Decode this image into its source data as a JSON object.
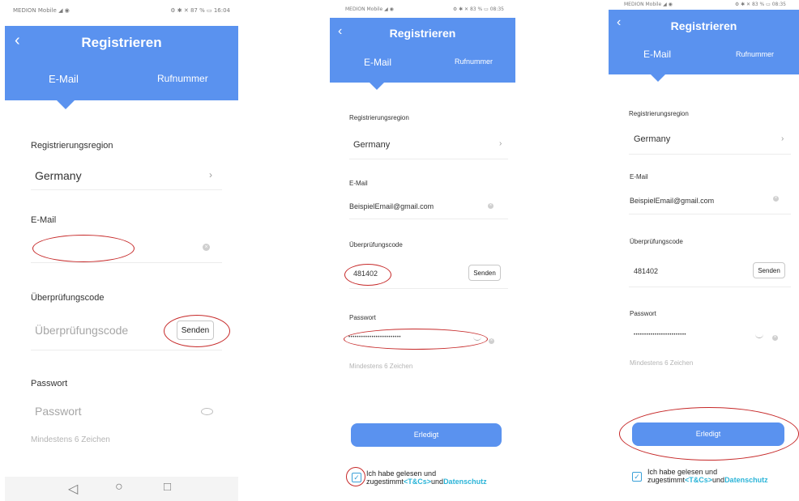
{
  "screens": [
    {
      "status_left": "MEDION Mobile ◢ ◉",
      "status_right": "⚙ ✱ ✕ 87 % ▭ 16:04",
      "title": "Registrieren",
      "tab_email": "E-Mail",
      "tab_phone": "Rufnummer",
      "region_label": "Registrierungsregion",
      "region_value": "Germany",
      "email_label": "E-Mail",
      "email_value": "",
      "code_label": "Überprüfungscode",
      "code_placeholder": "Überprüfungscode",
      "send_label": "Senden",
      "password_label": "Passwort",
      "password_placeholder": "Passwort",
      "password_hint": "Mindestens 6 Zeichen"
    },
    {
      "status_left": "MEDION Mobile ◢ ◉",
      "status_right": "⚙ ✱ ✕ 83 % ▭ 08:35",
      "title": "Registrieren",
      "tab_email": "E-Mail",
      "tab_phone": "Rufnummer",
      "region_label": "Registrierungsregion",
      "region_value": "Germany",
      "email_label": "E-Mail",
      "email_value": "BeispielEmail@gmail.com",
      "code_label": "Überprüfungscode",
      "code_value": "481402",
      "send_label": "Senden",
      "password_label": "Passwort",
      "password_dots": "•••••••••••••••••••••••••",
      "password_hint": "Mindestens 6 Zeichen",
      "done_label": "Erledigt",
      "terms_line1": "Ich habe gelesen und",
      "terms_prefix": "zugestimmt",
      "terms_link1": "<T&Cs>",
      "terms_and": "und",
      "terms_link2": "Datenschutz"
    },
    {
      "status_left": "MEDION Mobile ◢ ◉",
      "status_right": "⚙ ✱ ✕ 83 % ▭ 08:35",
      "title": "Registrieren",
      "tab_email": "E-Mail",
      "tab_phone": "Rufnummer",
      "region_label": "Registrierungsregion",
      "region_value": "Germany",
      "email_label": "E-Mail",
      "email_value": "BeispielEmail@gmail.com",
      "code_label": "Überprüfungscode",
      "code_value": "481402",
      "send_label": "Senden",
      "password_label": "Passwort",
      "password_dots": "•••••••••••••••••••••••••",
      "password_hint": "Mindestens 6 Zeichen",
      "done_label": "Erledigt",
      "terms_line1": "Ich habe gelesen und",
      "terms_prefix": "zugestimmt",
      "terms_link1": "<T&Cs>",
      "terms_and": "und",
      "terms_link2": "Datenschutz"
    }
  ],
  "nav_icons": [
    "back-triangle-icon",
    "home-circle-icon",
    "recents-square-icon"
  ],
  "colors": {
    "header": "#5a92ef",
    "annotation": "#c62828",
    "link": "#2ab4d8"
  }
}
